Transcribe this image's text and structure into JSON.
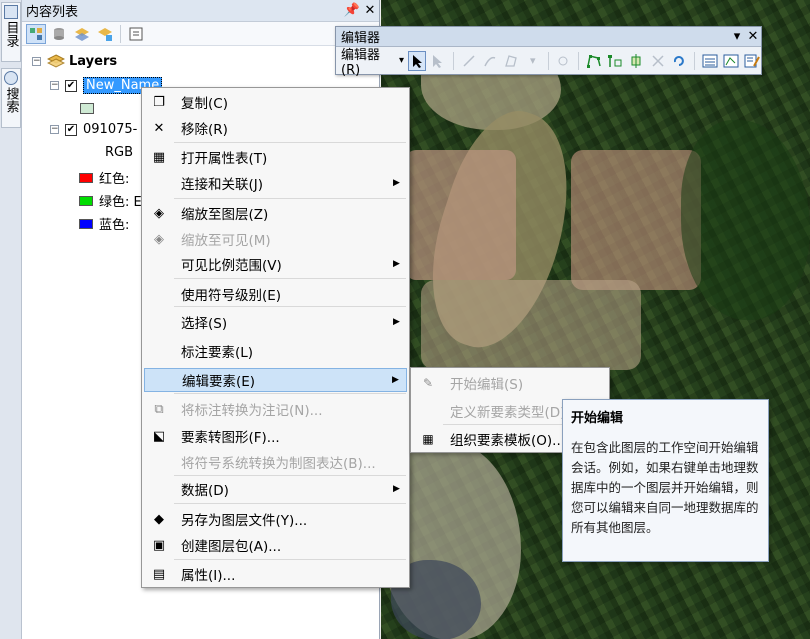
{
  "sidebar_tabs": [
    {
      "label": "目录",
      "icon": "catalog-icon"
    },
    {
      "label": "搜索",
      "icon": "search-icon"
    }
  ],
  "toc": {
    "title": "内容列表",
    "pin_glyph": "ᵖ",
    "close_glyph": "✕",
    "root": "Layers",
    "layer1_name": "New_Name",
    "layer2_name": "091075-",
    "rgb_label": "RGB",
    "bands": [
      {
        "label": "红色:",
        "color": "#ff0000"
      },
      {
        "label": "绿色: E",
        "color": "#00dd00"
      },
      {
        "label": "蓝色:",
        "color": "#0000ff"
      }
    ],
    "layer1_swatch_color": "#cfead4"
  },
  "editor_toolbar": {
    "title": "编辑器",
    "menu_label": "编辑器(R)",
    "dropdown_glyph": "▾"
  },
  "context_menu": {
    "items": [
      {
        "label": "复制(C)",
        "icon": "copy-icon",
        "glyph": "❐"
      },
      {
        "label": "移除(R)",
        "icon": "remove-icon",
        "glyph": "✕"
      },
      {
        "label": "打开属性表(T)",
        "icon": "table-icon",
        "glyph": "▦"
      },
      {
        "label": "连接和关联(J)",
        "icon": "",
        "glyph": "",
        "submenu": true
      },
      {
        "label": "缩放至图层(Z)",
        "icon": "zoom-to-layer-icon",
        "glyph": "◈"
      },
      {
        "label": "缩放至可见(M)",
        "icon": "zoom-visible-icon",
        "glyph": "◈",
        "disabled": true
      },
      {
        "label": "可见比例范围(V)",
        "icon": "",
        "glyph": "",
        "submenu": true
      },
      {
        "label": "使用符号级别(E)",
        "icon": "",
        "glyph": ""
      },
      {
        "label": "选择(S)",
        "icon": "",
        "glyph": "",
        "submenu": true
      },
      {
        "label": "标注要素(L)",
        "icon": "",
        "glyph": ""
      },
      {
        "label": "编辑要素(E)",
        "icon": "",
        "glyph": "",
        "submenu": true,
        "highlighted": true
      },
      {
        "label": "将标注转换为注记(N)...",
        "icon": "convert-labels-icon",
        "glyph": "⧉",
        "disabled": true
      },
      {
        "label": "要素转图形(F)...",
        "icon": "features-to-graphics-icon",
        "glyph": "⬕"
      },
      {
        "label": "将符号系统转换为制图表达(B)...",
        "icon": "",
        "glyph": "",
        "disabled": true
      },
      {
        "label": "数据(D)",
        "icon": "",
        "glyph": "",
        "submenu": true
      },
      {
        "label": "另存为图层文件(Y)...",
        "icon": "layer-file-icon",
        "glyph": "◆"
      },
      {
        "label": "创建图层包(A)...",
        "icon": "layer-package-icon",
        "glyph": "▣"
      },
      {
        "label": "属性(I)...",
        "icon": "properties-icon",
        "glyph": "▤"
      }
    ],
    "arrow_glyph": "▶"
  },
  "submenu": {
    "items": [
      {
        "label": "开始编辑(S)",
        "icon": "start-edit-icon",
        "glyph": "✎",
        "disabled": true
      },
      {
        "label": "定义新要素类型(D)...",
        "icon": "",
        "glyph": "",
        "disabled": true
      },
      {
        "label": "组织要素模板(O)...",
        "icon": "organize-templates-icon",
        "glyph": "▦"
      }
    ]
  },
  "tooltip": {
    "title": "开始编辑",
    "body": "在包含此图层的工作空间开始编辑会话。例如，如果右键单击地理数据库中的一个图层并开始编辑，则您可以编辑来自同一地理数据库的所有其他图层。"
  },
  "colors": {
    "selection_blue": "#3399ff",
    "menu_highlight": "#cde3f8"
  }
}
